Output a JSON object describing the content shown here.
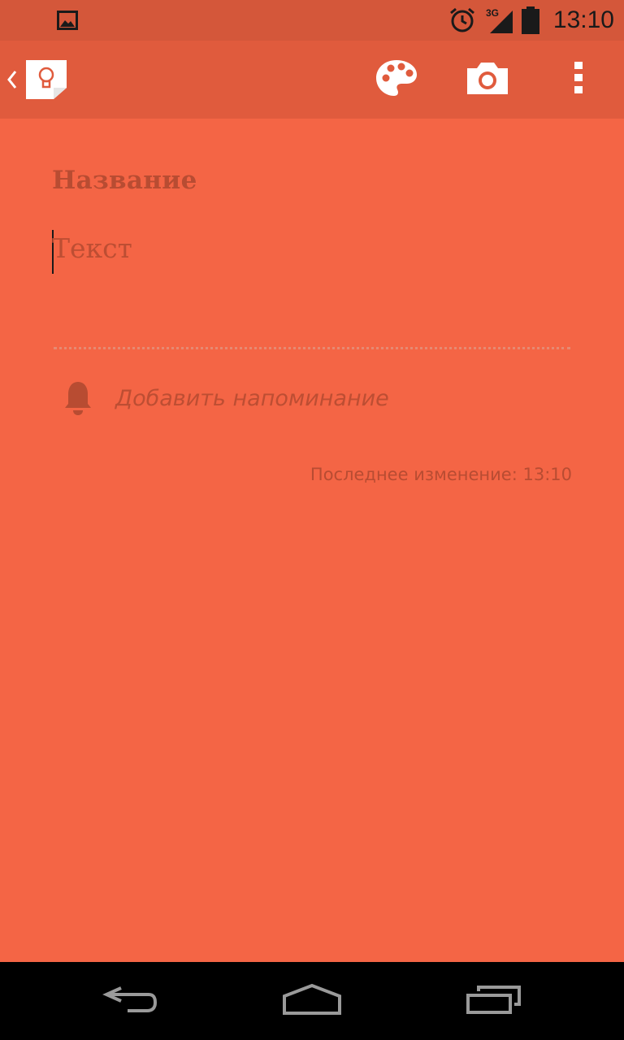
{
  "status_bar": {
    "time": "13:10",
    "network": "3G",
    "icons": [
      "image-notification-icon",
      "alarm-icon",
      "signal-icon",
      "battery-icon"
    ]
  },
  "action_bar": {
    "icons": [
      "back-chevron-icon",
      "keep-app-icon",
      "palette-icon",
      "camera-icon",
      "overflow-menu-icon"
    ]
  },
  "note": {
    "title_placeholder": "Название",
    "text_placeholder": "Текст",
    "reminder_label": "Добавить напоминание",
    "last_modified": "Последнее изменение: 13:10"
  },
  "nav_bar": {
    "icons": [
      "back-icon",
      "home-icon",
      "recents-icon"
    ]
  },
  "colors": {
    "note_background": "#f46545",
    "action_bar": "#e05b3d",
    "status_bar": "#d4573a",
    "text_muted": "#bd4e33"
  }
}
